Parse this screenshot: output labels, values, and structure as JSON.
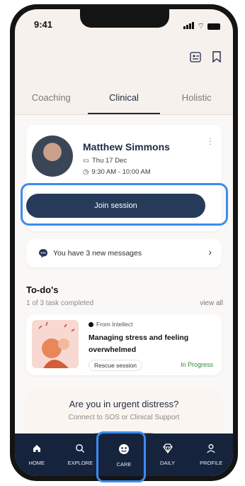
{
  "status_bar": {
    "time": "9:41"
  },
  "tabs": [
    {
      "label": "Coaching",
      "active": false
    },
    {
      "label": "Clinical",
      "active": true
    },
    {
      "label": "Holistic",
      "active": false
    }
  ],
  "session_card": {
    "name": "Matthew Simmons",
    "date": "Thu 17 Dec",
    "time": "9:30 AM - 10:00 AM",
    "join_label": "Join session",
    "menu_icon": "more-vertical-icon"
  },
  "messages": {
    "text": "You have 3 new messages",
    "icon": "chat-icon"
  },
  "todos": {
    "title": "To-do's",
    "subtitle": "1 of 3 task completed",
    "view_all": "view all",
    "items": [
      {
        "source": "From Intellect",
        "title": "Managing stress and feeling overwhelmed",
        "chip": "Rescue session",
        "status": "In Progress"
      }
    ]
  },
  "distress": {
    "title": "Are you in urgent distress?",
    "subtitle": "Connect to SOS or Clinical Support"
  },
  "bottom_nav": [
    {
      "label": "HOME",
      "icon": "home-icon"
    },
    {
      "label": "EXPLORE",
      "icon": "search-icon"
    },
    {
      "label": "CARE",
      "icon": "care-icon"
    },
    {
      "label": "DAILY",
      "icon": "diamond-icon"
    },
    {
      "label": "PROFILE",
      "icon": "person-icon"
    }
  ],
  "colors": {
    "accent": "#263a5a",
    "highlight": "#3d8bf0",
    "nav_bg": "#16233d",
    "success": "#2f8a3b"
  }
}
